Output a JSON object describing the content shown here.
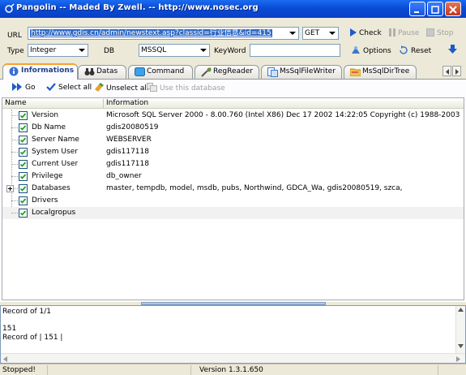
{
  "window": {
    "title": "Pangolin -- Maded By Zwell. -- http://www.nosec.org"
  },
  "form": {
    "url_label": "URL",
    "url_value": "http://www.gdis.cn/admin/newstext.asp?classid=行业信息&id=415",
    "method_value": "GET",
    "type_label": "Type",
    "type_value": "Integer",
    "db_label": "DB",
    "db_value": "MSSQL",
    "keyword_label": "KeyWord",
    "keyword_value": "",
    "check_label": "Check",
    "pause_label": "Pause",
    "stop_label": "Stop",
    "options_label": "Options",
    "reset_label": "Reset"
  },
  "tabs": [
    {
      "label": "Informations",
      "active": true,
      "icon": "info-icon"
    },
    {
      "label": "Datas",
      "active": false,
      "icon": "binoculars-icon"
    },
    {
      "label": "Command",
      "active": false,
      "icon": "command-icon"
    },
    {
      "label": "RegReader",
      "active": false,
      "icon": "registry-icon"
    },
    {
      "label": "MsSqlFileWriter",
      "active": false,
      "icon": "file-writer-icon"
    },
    {
      "label": "MsSqlDirTree",
      "active": false,
      "icon": "folder-icon"
    }
  ],
  "actions": {
    "go_label": "Go",
    "select_all_label": "Select all",
    "unselect_all_label": "Unselect all",
    "use_db_label": "Use this database"
  },
  "grid": {
    "col_name": "Name",
    "col_info": "Information",
    "rows": [
      {
        "name": "Version",
        "info": "Microsoft SQL Server  2000 - 8.00.760 (Intel X86) Dec 17 2002 14:22:05 Copyright (c) 1988-2003 ...",
        "checked": true,
        "expandable": false
      },
      {
        "name": "Db Name",
        "info": "gdis20080519",
        "checked": true,
        "expandable": false
      },
      {
        "name": "Server Name",
        "info": "WEBSERVER",
        "checked": true,
        "expandable": false
      },
      {
        "name": "System User",
        "info": "gdis117118",
        "checked": true,
        "expandable": false
      },
      {
        "name": "Current User",
        "info": "gdis117118",
        "checked": true,
        "expandable": false
      },
      {
        "name": "Privilege",
        "info": "db_owner",
        "checked": true,
        "expandable": false
      },
      {
        "name": "Databases",
        "info": "master, tempdb, model, msdb, pubs, Northwind, GDCA_Wa, gdis20080519, szca,",
        "checked": true,
        "expandable": true
      },
      {
        "name": "Drivers",
        "info": "",
        "checked": true,
        "expandable": false
      },
      {
        "name": "Localgropus",
        "info": "",
        "checked": true,
        "expandable": false
      }
    ]
  },
  "log": {
    "lines": [
      "Record of 1/1",
      "",
      "151",
      "Record of  | 151 |"
    ]
  },
  "status": {
    "state": "Stopped!",
    "version": "Version 1.3.1.650"
  },
  "colors": {
    "titlebar": "#0a4bd6",
    "active_tab_accent": "#f9a030",
    "selection": "#316ac5"
  }
}
